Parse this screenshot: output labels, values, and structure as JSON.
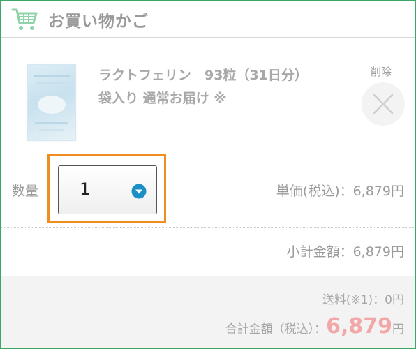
{
  "header": {
    "title": "お買い物かご",
    "icon": "shopping-cart-icon",
    "icon_color": "#8fd3a8"
  },
  "item": {
    "name": "ラクトフェリン　93粒（31日分）",
    "option": "袋入り 通常お届け ※",
    "image": "product-package-image",
    "delete_label": "削除",
    "delete_icon": "close-icon"
  },
  "quantity": {
    "label": "数量",
    "colon": "：",
    "value": "1",
    "dropdown_icon": "chevron-down-circle-icon",
    "accent_color": "#1a8fc7",
    "highlight_color": "#ef8d21"
  },
  "pricing": {
    "unit_price": "単価(税込)：6,879円",
    "subtotal": "小計金額：6,879円",
    "shipping": "送料(※1)：0円",
    "total_label": "合計金額（税込）：",
    "total_amount": "6,879",
    "total_unit": "円",
    "total_color": "#f2a7a8"
  },
  "colors": {
    "border": "#3aa767"
  }
}
